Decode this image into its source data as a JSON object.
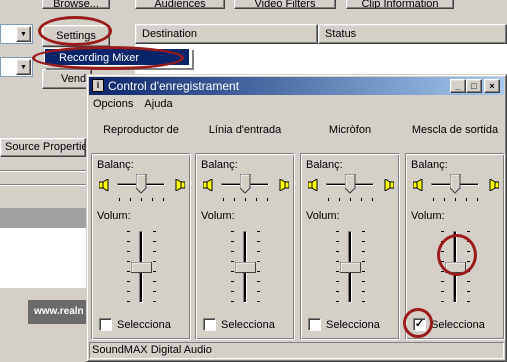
{
  "background_app": {
    "top_buttons": [
      "Browse...",
      "Audiences",
      "Video Filters",
      "Clip Information"
    ],
    "settings_label": "Settings",
    "vend_label": "Vend",
    "list_columns": [
      "Destination",
      "Status"
    ],
    "source_properties_label": "Source Properties",
    "logo_text": "www.realn"
  },
  "settings_menu": {
    "items": [
      "Recording Mixer"
    ]
  },
  "dialog": {
    "title": "Control d'enregistrament",
    "menu": [
      "Opcions",
      "Ajuda"
    ],
    "balance_label": "Balanç:",
    "volume_label": "Volum:",
    "select_label": "Selecciona",
    "status": "SoundMAX Digital Audio",
    "channels": [
      {
        "name": "Reproductor de",
        "balance": 0.5,
        "volume": 0.5,
        "selected": false
      },
      {
        "name": "Línia d'entrada",
        "balance": 0.5,
        "volume": 0.5,
        "selected": false
      },
      {
        "name": "Micròfon",
        "balance": 0.5,
        "volume": 0.5,
        "selected": false
      },
      {
        "name": "Mescla de sortida",
        "balance": 0.5,
        "volume": 0.5,
        "selected": true
      }
    ]
  },
  "colors": {
    "titlebar_start": "#0a246a",
    "titlebar_end": "#a6caf0",
    "annotation_ring": "#9b1b1b",
    "window_face": "#d4d0c8"
  },
  "icons": [
    "speaker-icon",
    "close-icon",
    "minimize-icon",
    "maximize-icon",
    "check-icon",
    "dropdown-arrow-icon"
  ]
}
